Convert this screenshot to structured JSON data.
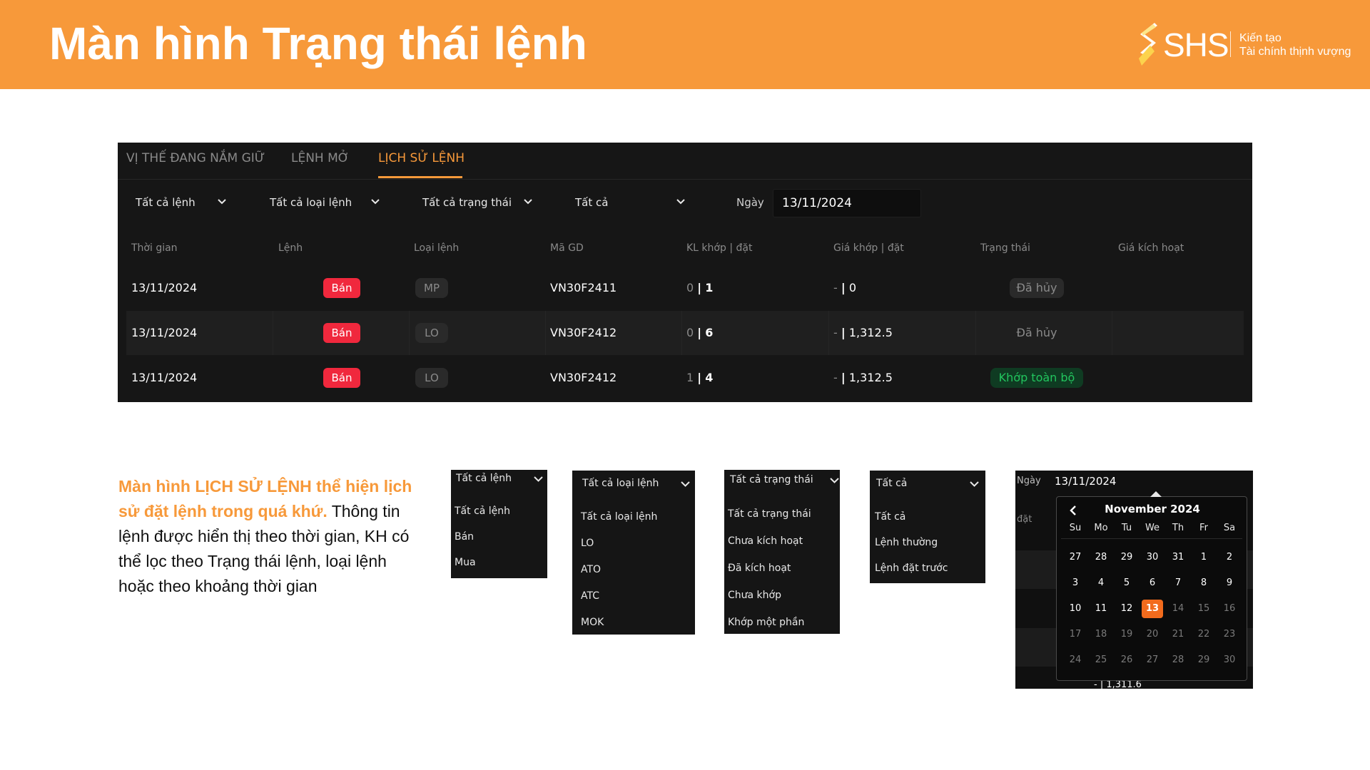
{
  "header": {
    "title": "Màn hình Trạng thái lệnh",
    "logo_text": "SHS",
    "tagline_line1": "Kiến tạo",
    "tagline_line2": "Tài chính thịnh vượng"
  },
  "panel": {
    "tabs": [
      {
        "label": "VỊ THẾ ĐANG NẮM GIỮ",
        "active": false
      },
      {
        "label": "LỆNH MỞ",
        "active": false
      },
      {
        "label": "LỊCH SỬ LỆNH",
        "active": true
      }
    ],
    "filters": {
      "order_side": "Tất cả lệnh",
      "order_type": "Tất cả loại lệnh",
      "status": "Tất cả trạng thái",
      "trigger": "Tất cả",
      "date_label": "Ngày",
      "date_value": "13/11/2024"
    },
    "columns": [
      "Thời gian",
      "Lệnh",
      "Loại lệnh",
      "Mã GD",
      "KL khớp | đặt",
      "Giá khớp | đặt",
      "Trạng thái",
      "Giá kích hoạt"
    ],
    "rows": [
      {
        "time": "13/11/2024",
        "side": "Bán",
        "type": "MP",
        "code": "VN30F2411",
        "qty_matched": "0",
        "qty_order": "1",
        "price_matched": "-",
        "price_order": "0",
        "status": "Đã hủy",
        "trigger_price": ""
      },
      {
        "time": "13/11/2024",
        "side": "Bán",
        "type": "LO",
        "code": "VN30F2412",
        "qty_matched": "0",
        "qty_order": "6",
        "price_matched": "-",
        "price_order": "1,312.5",
        "status": "Đã hủy",
        "trigger_price": ""
      },
      {
        "time": "13/11/2024",
        "side": "Bán",
        "type": "LO",
        "code": "VN30F2412",
        "qty_matched": "1",
        "qty_order": "4",
        "price_matched": "-",
        "price_order": "1,312.5",
        "status": "Khớp toàn bộ",
        "trigger_price": ""
      }
    ]
  },
  "description": {
    "highlight": "Màn hình LỊCH SỬ LỆNH thể hiện lịch sử đặt lệnh trong quá khứ.",
    "body": "Thông tin lệnh được hiển thị theo thời gian, KH có thể lọc theo Trạng thái lệnh, loại lệnh hoặc theo khoảng thời gian"
  },
  "dropdowns": {
    "side": {
      "head": "Tất cả lệnh",
      "items": [
        "Tất cả lệnh",
        "Bán",
        "Mua"
      ]
    },
    "type": {
      "head": "Tất cả loại lệnh",
      "items": [
        "Tất cả loại lệnh",
        "LO",
        "ATO",
        "ATC",
        "MOK"
      ]
    },
    "status": {
      "head": "Tất cả trạng thái",
      "items": [
        "Tất cả trạng thái",
        "Chưa kích hoạt",
        "Đã kích hoạt",
        "Chưa khớp",
        "Khớp một phần"
      ]
    },
    "trigger": {
      "head": "Tất cả",
      "items": [
        "Tất cả",
        "Lệnh thường",
        "Lệnh đặt trước"
      ]
    }
  },
  "calendar": {
    "date_label": "Ngày",
    "date_value": "13/11/2024",
    "bg_label": "đặt",
    "bg_value": "- | 1,311.6",
    "month_title": "November 2024",
    "weekdays": [
      "Su",
      "Mo",
      "Tu",
      "We",
      "Th",
      "Fr",
      "Sa"
    ],
    "weeks": [
      [
        "27",
        "28",
        "29",
        "30",
        "31",
        "1",
        "2"
      ],
      [
        "3",
        "4",
        "5",
        "6",
        "7",
        "8",
        "9"
      ],
      [
        "10",
        "11",
        "12",
        "13",
        "14",
        "15",
        "16"
      ],
      [
        "17",
        "18",
        "19",
        "20",
        "21",
        "22",
        "23"
      ],
      [
        "24",
        "25",
        "26",
        "27",
        "28",
        "29",
        "30"
      ]
    ],
    "selected": "13"
  },
  "colors": {
    "brand_orange": "#F7993A",
    "sell_red": "#F0283D",
    "match_green": "#22c55e"
  }
}
